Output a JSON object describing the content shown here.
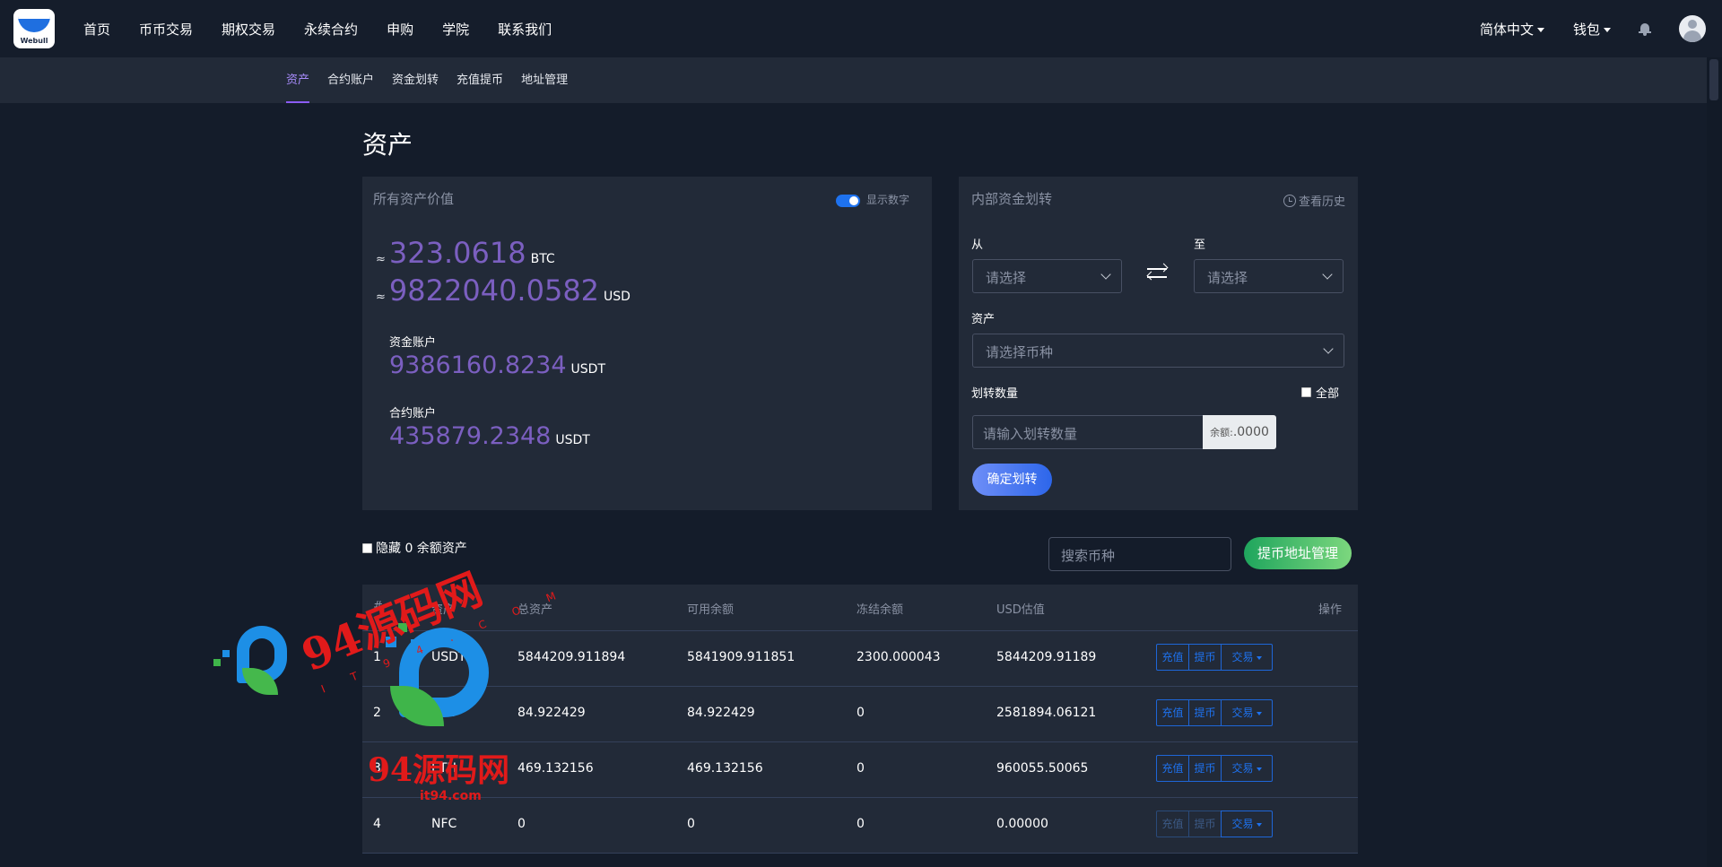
{
  "header": {
    "logo_text": "Webull",
    "nav": [
      "首页",
      "币币交易",
      "期权交易",
      "永续合约",
      "申购",
      "学院",
      "联系我们"
    ],
    "language": "简体中文",
    "wallet": "钱包"
  },
  "subnav": {
    "items": [
      "资产",
      "合约账户",
      "资金划转",
      "充值提币",
      "地址管理"
    ],
    "active": "资产"
  },
  "page": {
    "title": "资产"
  },
  "assets_card": {
    "label": "所有资产价值",
    "toggle_label": "显示数字",
    "toggle_on": true,
    "approx": "≈",
    "btc_value": "323.0618",
    "btc_unit": "BTC",
    "usd_value": "9822040.0582",
    "usd_unit": "USD",
    "fund_account_label": "资金账户",
    "fund_account_value": "9386160.8234",
    "fund_account_unit": "USDT",
    "contract_account_label": "合约账户",
    "contract_account_value": "435879.2348",
    "contract_account_unit": "USDT"
  },
  "transfer_card": {
    "title": "内部资金划转",
    "history": "查看历史",
    "from_label": "从",
    "to_label": "至",
    "from_placeholder": "请选择",
    "to_placeholder": "请选择",
    "asset_label": "资产",
    "asset_placeholder": "请选择币种",
    "amount_label": "划转数量",
    "all_label": "全部",
    "amount_placeholder": "请输入划转数量",
    "balance_label": "余额:",
    "balance_value": ".0000",
    "confirm": "确定划转"
  },
  "list_controls": {
    "hide_zero": "隐藏 0 余额资产",
    "search_placeholder": "搜索币种",
    "address_button": "提币地址管理"
  },
  "table": {
    "headers": [
      "#",
      "资产",
      "总资产",
      "可用余额",
      "冻结余额",
      "USD估值",
      "操作"
    ],
    "rows": [
      {
        "index": "1",
        "asset": "USDT",
        "total": "5844209.911894",
        "available": "5841909.911851",
        "frozen": "2300.000043",
        "usd": "5844209.91189"
      },
      {
        "index": "2",
        "asset": "BTC",
        "total": "84.922429",
        "available": "84.922429",
        "frozen": "0",
        "usd": "2581894.06121"
      },
      {
        "index": "3",
        "asset": "ETH",
        "total": "469.132156",
        "available": "469.132156",
        "frozen": "0",
        "usd": "960055.50065"
      },
      {
        "index": "4",
        "asset": "NFC",
        "total": "0",
        "available": "0",
        "frozen": "0",
        "usd": "0.00000"
      }
    ],
    "actions": {
      "deposit": "充值",
      "withdraw": "提币",
      "trade": "交易"
    }
  },
  "watermark": {
    "text_main": "94源码网",
    "text_arc": "I T 9 4 . C O M",
    "text_url": "it94.com"
  }
}
